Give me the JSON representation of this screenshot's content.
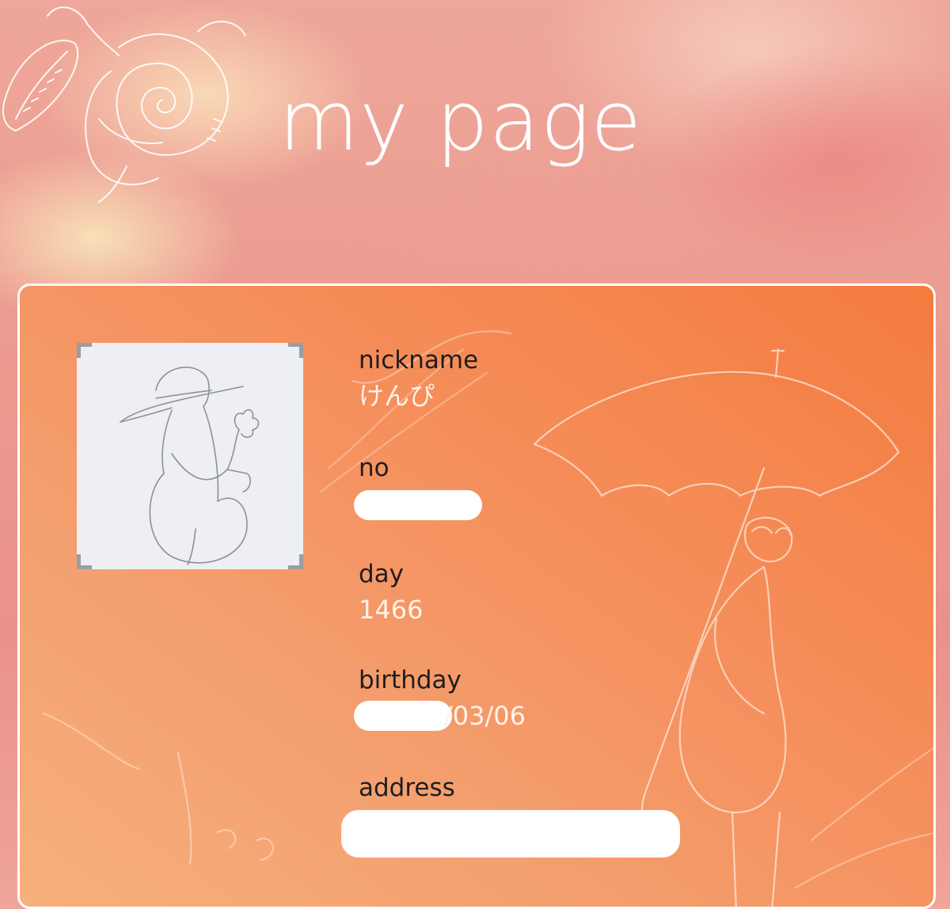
{
  "page": {
    "title": "my page",
    "decoration_icon": "rose-sketch-icon"
  },
  "card": {
    "avatar_icon": "hat-figure-sketch-icon",
    "background_art_icon": "umbrella-figure-sketch-icon",
    "fields": {
      "nickname": {
        "label": "nickname",
        "value": "けんぴ"
      },
      "no": {
        "label": "no",
        "value": ""
      },
      "day": {
        "label": "day",
        "value": "1466"
      },
      "birthday": {
        "label": "birthday",
        "value": "/03/06"
      },
      "address": {
        "label": "address",
        "value": ""
      }
    }
  },
  "colors": {
    "card_gradient_start": "#f6b07c",
    "card_gradient_end": "#f47b3e",
    "value_text": "#fff3ea",
    "label_text": "#1e1e1e"
  }
}
